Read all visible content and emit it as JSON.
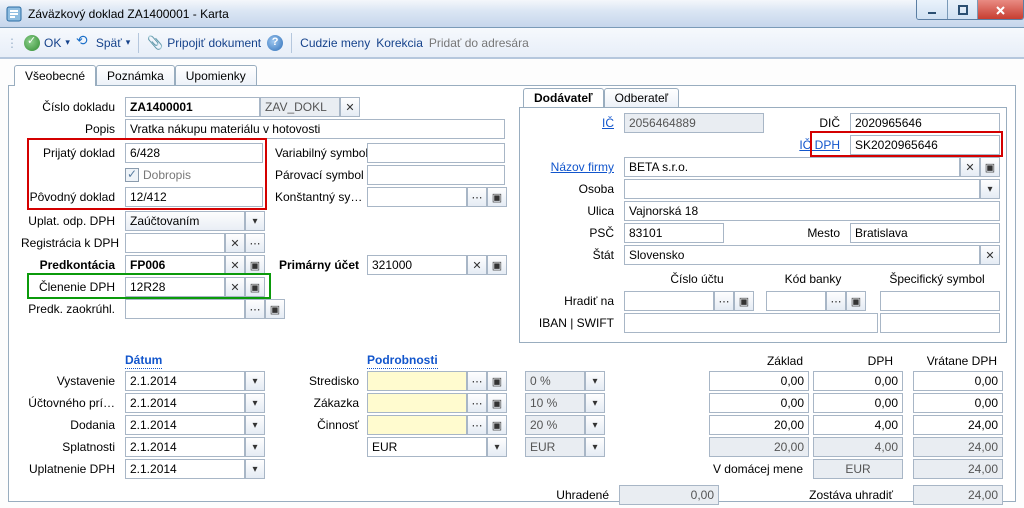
{
  "window": {
    "title": "Záväzkový doklad ZA1400001 - Karta"
  },
  "toolbar": {
    "ok": "OK",
    "spat": "Späť",
    "pripojit": "Pripojiť dokument",
    "cudzie_meny": "Cudzie meny",
    "korekcia": "Korekcia",
    "pridat_adresar": "Pridať do adresára"
  },
  "tabs": {
    "vseobecne": "Všeobecné",
    "poznamka": "Poznámka",
    "upomienky": "Upomienky"
  },
  "left": {
    "cislo_dokladu_l": "Číslo dokladu",
    "cislo_dokladu": "ZA1400001",
    "cislo_dokladu_kod": "ZAV_DOKL",
    "popis_l": "Popis",
    "popis": "Vratka nákupu materiálu v hotovosti",
    "prijaty_l": "Prijatý doklad",
    "prijaty": "6/428",
    "dobropis_l": "Dobropis",
    "povodny_l": "Pôvodný doklad",
    "povodny": "12/412",
    "uplat_l": "Uplat. odp. DPH",
    "uplat": "Zaúčtovaním",
    "registracia_l": "Registrácia k DPH",
    "predkontacia_l": "Predkontácia",
    "predkontacia": "FP006",
    "clenenie_l": "Členenie DPH",
    "clenenie": "12R28",
    "predk_zaokruhl_l": "Predk. zaokrúhl.",
    "var_sym_l": "Variabilný symbol",
    "par_sym_l": "Párovací symbol",
    "konst_sym_l": "Konštantný  sy…",
    "prim_ucet_l": "Primárny účet",
    "prim_ucet": "321000"
  },
  "datum": {
    "head": "Dátum",
    "vystavenie_l": "Vystavenie",
    "vystavenie": "2.1.2014",
    "uctovneho_l": "Účtovného prí…",
    "uctovneho": "2.1.2014",
    "dodania_l": "Dodania",
    "dodania": "2.1.2014",
    "splatnosti_l": "Splatnosti",
    "splatnosti": "2.1.2014",
    "uplatnenie_l": "Uplatnenie DPH",
    "uplatnenie": "2.1.2014"
  },
  "podrobnosti": {
    "head": "Podrobnosti",
    "stredisko_l": "Stredisko",
    "zakazka_l": "Zákazka",
    "cinnost_l": "Činnosť",
    "mena": "EUR"
  },
  "supplier": {
    "tab_dod": "Dodávateľ",
    "tab_odb": "Odberateľ",
    "ic_l": "IČ",
    "ic": "2056464889",
    "dic_l": "DIČ",
    "dic": "2020965646",
    "icdph_l": "IČ DPH",
    "icdph": "SK2020965646",
    "nazov_l": "Názov firmy",
    "nazov": "BETA s.r.o.",
    "osoba_l": "Osoba",
    "ulica_l": "Ulica",
    "ulica": "Vajnorská 18",
    "psc_l": "PSČ",
    "psc": "83101",
    "mesto_l": "Mesto",
    "mesto": "Bratislava",
    "stat_l": "Štát",
    "stat": "Slovensko",
    "cislo_uctu_l": "Číslo účtu",
    "kod_banky_l": "Kód banky",
    "spec_sym_l": "Špecifický symbol",
    "hradit_l": "Hradiť na",
    "iban_l": "IBAN | SWIFT"
  },
  "sums": {
    "zaklad_l": "Základ",
    "dph_l": "DPH",
    "vratane_l": "Vrátane DPH",
    "r0_rate": "0 %",
    "r0_zaklad": "0,00",
    "r0_dph": "0,00",
    "r0_vr": "0,00",
    "r1_rate": "10 %",
    "r1_zaklad": "0,00",
    "r1_dph": "0,00",
    "r1_vr": "0,00",
    "r2_rate": "20 %",
    "r2_zaklad": "20,00",
    "r2_dph": "4,00",
    "r2_vr": "24,00",
    "eur": "EUR",
    "r3_zaklad": "20,00",
    "r3_dph": "4,00",
    "r3_vr": "24,00",
    "domacej_l": "V domácej mene",
    "domacej_mena": "EUR",
    "domacej_val": "24,00",
    "uhradene_l": "Uhradené",
    "uhradene": "0,00",
    "zostava_l": "Zostáva uhradiť",
    "zostava": "24,00"
  }
}
